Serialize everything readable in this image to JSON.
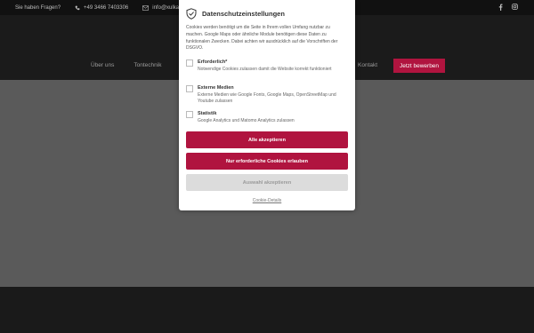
{
  "topbar": {
    "question": "Sie haben Fragen?",
    "phone": "+49 3466 7403306",
    "email": "info@xulkanevent"
  },
  "nav": {
    "items": [
      "Über uns",
      "Tontechnik",
      "Li"
    ],
    "kontakt": "Kontakt",
    "cta": "Jetzt bewerben"
  },
  "modal": {
    "title": "Datenschutzeinstellungen",
    "intro": "Cookies werden benötigt um die Seite in Ihrem vollen Umfang nutzbar zu machen. Google Maps oder ähnliche Module benötigen diese Daten zu funktionalen Zwecken. Dabei achten wir ausdrücklich auf die Vorschriften der DSGVO.",
    "options": [
      {
        "title": "Erforderlich*",
        "desc": "Notwendige Cookies zulassen damit die Website korrekt funktioniert"
      },
      {
        "title": "Externe Medien",
        "desc": "Externe Medien wie Google Fonts, Google Maps, OpenStreetMap und Youtube zulassen"
      },
      {
        "title": "Statistik",
        "desc": "Google Analytics und Matomo Analytics zulassen"
      }
    ],
    "accept_all": "Alle akzeptieren",
    "accept_necessary": "Nur erforderliche Cookies erlauben",
    "accept_selection": "Auswahl akzeptieren",
    "details_link": "Cookie-Details"
  },
  "colors": {
    "accent": "#b0143f",
    "hero_bg": "#5a5a5a",
    "dark_bg": "#1b1b1b"
  }
}
